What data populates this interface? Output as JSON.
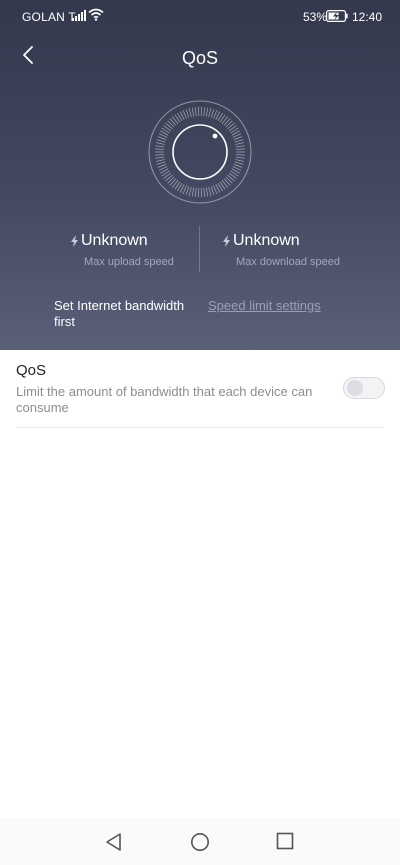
{
  "status_bar": {
    "carrier": "GOLAN T",
    "battery_percent": "53%",
    "time": "12:40",
    "icons": [
      "signal-icon",
      "wifi-icon",
      "battery-icon"
    ]
  },
  "header": {
    "title": "QoS",
    "back_icon": "chevron-left-icon"
  },
  "speeds": {
    "upload": {
      "value": "Unknown",
      "label": "Max upload speed"
    },
    "download": {
      "value": "Unknown",
      "label": "Max download speed"
    }
  },
  "bandwidth": {
    "note": "Set Internet bandwidth first",
    "link": "Speed limit settings"
  },
  "qos_setting": {
    "title": "QoS",
    "description": "Limit the amount of bandwidth that each device can consume",
    "enabled": false
  },
  "nav_bar": {
    "icons": [
      "back-triangle-icon",
      "home-circle-icon",
      "recents-square-icon"
    ]
  },
  "colors": {
    "hero_top": "#33384c",
    "hero_bottom": "#5b6079",
    "link": "#9aa0b4",
    "secondary_text": "#8b8d96"
  }
}
